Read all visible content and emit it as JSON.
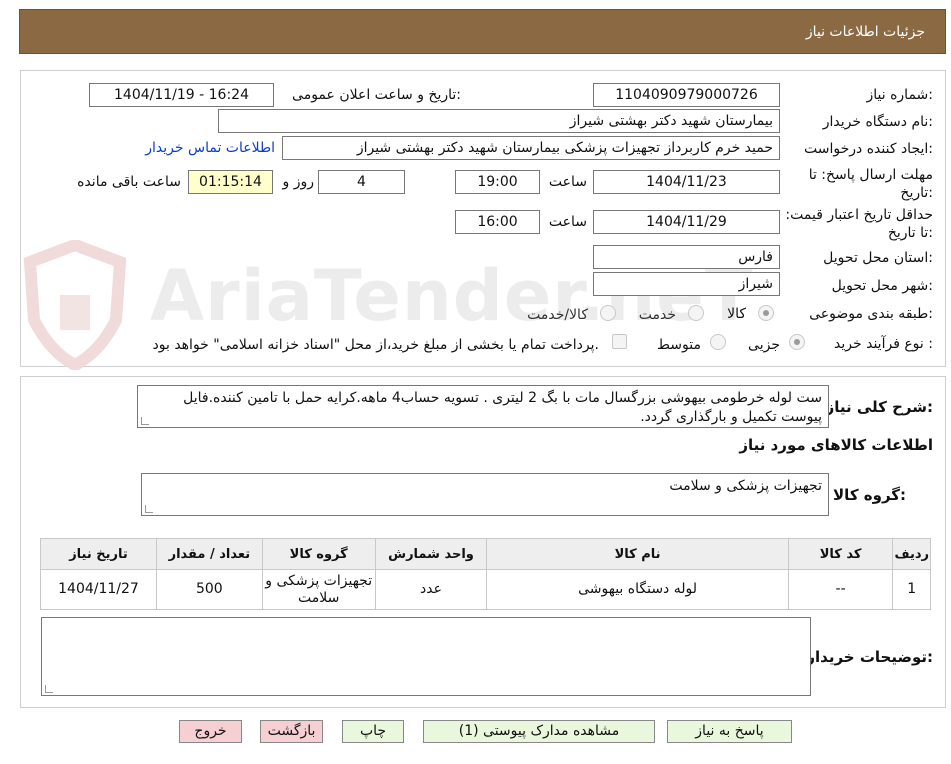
{
  "header": {
    "title": "جزئیات اطلاعات نیاز"
  },
  "watermark": {
    "text": "AriaTender.neT"
  },
  "labels": {
    "need_number": "شماره نیاز:",
    "announce_datetime": "تاریخ و ساعت اعلان عمومی:",
    "buyer_org": "نام دستگاه خریدار:",
    "requester": "ایجاد کننده درخواست:",
    "contact_link": "اطلاعات تماس خریدار",
    "deadline": "مهلت ارسال پاسخ: تا تاریخ:",
    "time_word": "ساعت",
    "day_word": "روز و",
    "remaining": "ساعت باقی مانده",
    "price_validity": "حداقل تاریخ اعتبار قیمت: تا تاریخ:",
    "province": "استان محل تحویل:",
    "city": "شهر محل تحویل:",
    "category": "طبقه بندی موضوعی:",
    "purchase_type": "نوع فرآیند خرید :",
    "description": "شرح کلی نیاز:",
    "goods_info": "اطلاعات کالاهای مورد نیاز",
    "goods_group": "گروه کالا:",
    "buyer_notes": "توضیحات خریدار:"
  },
  "values": {
    "need_number": "1104090979000726",
    "announce_datetime": "1404/11/19 - 16:24",
    "buyer_org": "بیمارستان شهید دکتر بهشتی شیراز",
    "requester": "حمید خرم کاربرداز تجهیزات پزشکی بیمارستان شهید دکتر بهشتی شیراز",
    "deadline_date": "1404/11/23",
    "deadline_time": "19:00",
    "days_left": "4",
    "time_left": "01:15:14",
    "validity_date": "1404/11/29",
    "validity_time": "16:00",
    "province": "فارس",
    "city": "شیراز",
    "description": "ست لوله خرطومی بیهوشی  بزرگسال مات با بگ 2 لیتری . تسویه حساب4 ماهه.کرایه حمل با تامین کننده.فایل پیوست تکمیل و بارگذاری گردد.",
    "goods_group": "تجهیزات پزشکی و سلامت",
    "buyer_notes": ""
  },
  "category_options": [
    "کالا",
    "خدمت",
    "کالا/خدمت"
  ],
  "category_selected": "کالا",
  "purchase_options": [
    "جزیی",
    "متوسط"
  ],
  "purchase_selected": "جزیی",
  "payment_note": "پرداخت تمام یا بخشی از مبلغ خرید،از محل \"اسناد خزانه اسلامی\" خواهد بود.",
  "table": {
    "headers": [
      "ردیف",
      "کد کالا",
      "نام کالا",
      "واحد شمارش",
      "گروه کالا",
      "تعداد / مقدار",
      "تاریخ نیاز"
    ],
    "rows": [
      [
        "1",
        "--",
        "لوله دستگاه بیهوشی",
        "عدد",
        "تجهیزات پزشکی و سلامت",
        "500",
        "1404/11/27"
      ]
    ]
  },
  "buttons": {
    "reply": "پاسخ به نیاز",
    "attachments": "مشاهده مدارک پیوستی (1)",
    "print": "چاپ",
    "back": "بازگشت",
    "exit": "خروج"
  }
}
